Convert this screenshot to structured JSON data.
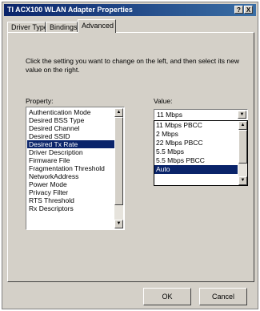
{
  "window": {
    "title": "TI ACX100 WLAN Adapter Properties",
    "help_label": "?",
    "close_label": "X"
  },
  "tabs": [
    {
      "label": "Driver Type"
    },
    {
      "label": "Bindings"
    },
    {
      "label": "Advanced"
    }
  ],
  "instructions": "Click the setting you want to change on the left, and then select its new value on the right.",
  "property": {
    "label": "Property:",
    "items": [
      "Authentication Mode",
      "Desired BSS Type",
      "Desired Channel",
      "Desired SSID",
      "Desired Tx Rate",
      "Driver Description",
      "Firmware File",
      "Fragmentation Threshold",
      "NetworkAddress",
      "Power Mode",
      "Privacy Filter",
      "RTS Threshold",
      "Rx Descriptors"
    ],
    "selected": "Desired Tx Rate"
  },
  "value": {
    "label": "Value:",
    "current": "11 Mbps",
    "options": [
      "11 Mbps PBCC",
      "2 Mbps",
      "22 Mbps PBCC",
      "5.5 Mbps",
      "5.5 Mbps PBCC",
      "Auto"
    ],
    "highlighted": "Auto"
  },
  "buttons": {
    "ok": "OK",
    "cancel": "Cancel"
  },
  "colors": {
    "titlebar": "#0a246a",
    "selection": "#0a246a",
    "face": "#d4d0c8"
  }
}
